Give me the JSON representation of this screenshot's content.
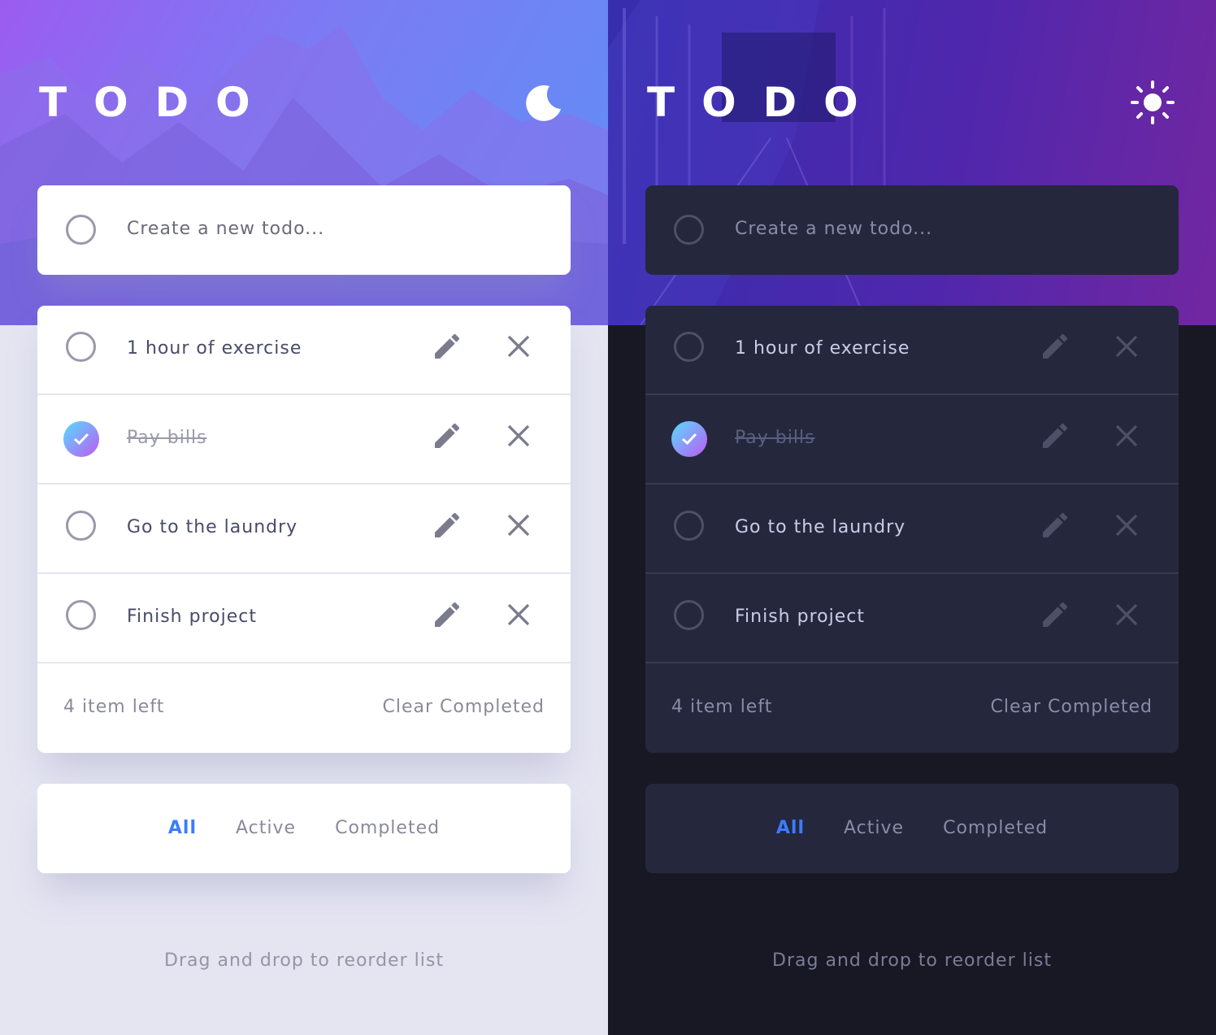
{
  "light": {
    "title": "TODO",
    "theme_icon": "moon-icon",
    "new_todo_placeholder": "Create a new todo...",
    "todos": [
      {
        "label": "1 hour of exercise",
        "completed": false
      },
      {
        "label": "Pay bills",
        "completed": true
      },
      {
        "label": "Go to the laundry",
        "completed": false
      },
      {
        "label": "Finish project",
        "completed": false
      }
    ],
    "footer": {
      "items_left": "4 item left",
      "clear_label": "Clear Completed"
    },
    "filters": {
      "all": "All",
      "active": "Active",
      "completed": "Completed",
      "selected": "All"
    },
    "hint": "Drag and drop to reorder list"
  },
  "dark": {
    "title": "TODO",
    "theme_icon": "sun-icon",
    "new_todo_placeholder": "Create a new todo...",
    "todos": [
      {
        "label": "1 hour of exercise",
        "completed": false
      },
      {
        "label": "Pay bills",
        "completed": true
      },
      {
        "label": "Go to the laundry",
        "completed": false
      },
      {
        "label": "Finish project",
        "completed": false
      }
    ],
    "footer": {
      "items_left": "4 item left",
      "clear_label": "Clear Completed"
    },
    "filters": {
      "all": "All",
      "active": "Active",
      "completed": "Completed",
      "selected": "All"
    },
    "hint": "Drag and drop to reorder list"
  },
  "colors": {
    "accent": "#3a7cfd",
    "check_gradient_start": "#55ddff",
    "check_gradient_end": "#c058f3",
    "light_bg": "#e4e5f1",
    "dark_bg": "#171823",
    "dark_card": "#25273d"
  }
}
